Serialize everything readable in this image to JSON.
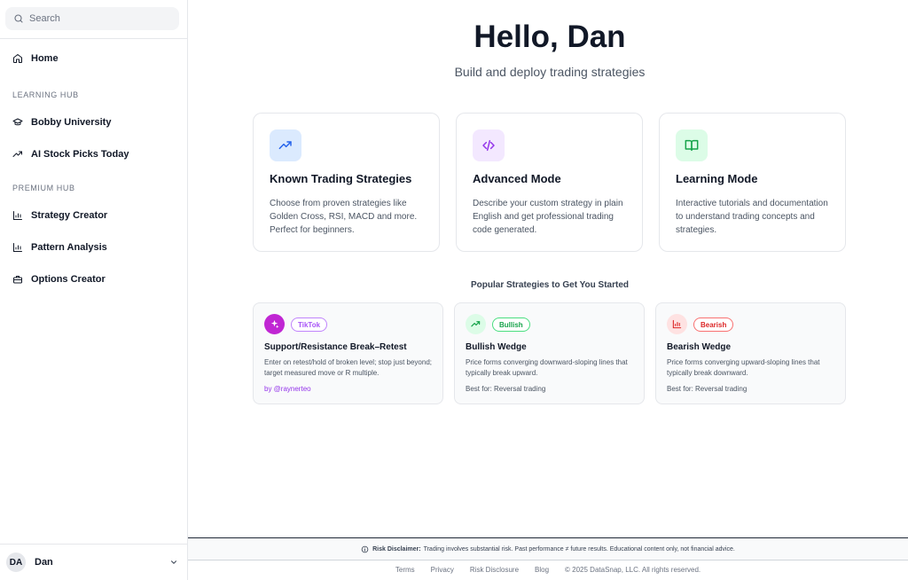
{
  "sidebar": {
    "search": {
      "placeholder": "Search"
    },
    "home": "Home",
    "learning_hub": {
      "title": "LEARNING HUB",
      "items": [
        "Bobby University",
        "AI Stock Picks Today"
      ]
    },
    "premium_hub": {
      "title": "PREMIUM HUB",
      "items": [
        "Strategy Creator",
        "Pattern Analysis",
        "Options Creator"
      ]
    },
    "user": {
      "initials": "DA",
      "name": "Dan"
    }
  },
  "main": {
    "greeting": "Hello, Dan",
    "subtitle": "Build and deploy trading strategies",
    "mode_cards": [
      {
        "title": "Known Trading Strategies",
        "description": "Choose from proven strategies like Golden Cross, RSI, MACD and more. Perfect for beginners.",
        "icon": "trending-up-icon",
        "color": "#2563eb",
        "bg": "#dbeafe"
      },
      {
        "title": "Advanced Mode",
        "description": "Describe your custom strategy in plain English and get professional trading code generated.",
        "icon": "code-icon",
        "color": "#9333ea",
        "bg": "#f3e8ff"
      },
      {
        "title": "Learning Mode",
        "description": "Interactive tutorials and documentation to understand trading concepts and strategies.",
        "icon": "book-open-icon",
        "color": "#16a34a",
        "bg": "#dcfce7"
      }
    ],
    "popular_title": "Popular Strategies to Get You Started",
    "strategies": [
      {
        "tag": "TikTok",
        "title": "Support/Resistance Break–Retest",
        "description": "Enter on retest/hold of broken level; stop just beyond; target measured move or R multiple.",
        "meta": "by @raynerteo",
        "icon": "sparkles-icon",
        "tag_color": "#a855f7"
      },
      {
        "tag": "Bullish",
        "title": "Bullish Wedge",
        "description": "Price forms converging downward-sloping lines that typically break upward.",
        "meta": "Best for: Reversal trading",
        "icon": "trending-up-icon",
        "tag_color": "#16a34a"
      },
      {
        "tag": "Bearish",
        "title": "Bearish Wedge",
        "description": "Price forms converging upward-sloping lines that typically break downward.",
        "meta": "Best for: Reversal trading",
        "icon": "bar-chart-icon",
        "tag_color": "#dc2626"
      }
    ]
  },
  "footer": {
    "disclaimer_label": "Risk Disclaimer:",
    "disclaimer_text": "Trading involves substantial risk. Past performance ≠ future results. Educational content only, not financial advice.",
    "links": [
      "Terms",
      "Privacy",
      "Risk Disclosure",
      "Blog"
    ],
    "copyright": "© 2025 DataSnap, LLC. All rights reserved."
  }
}
